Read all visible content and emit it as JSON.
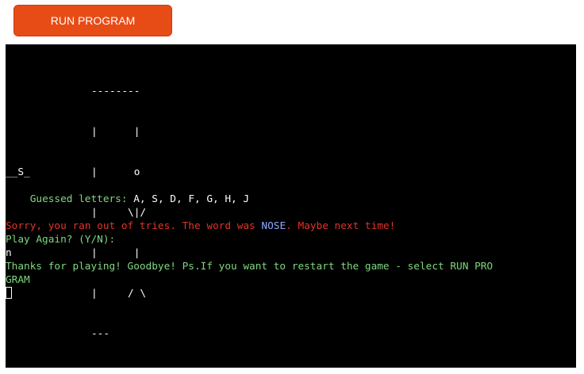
{
  "toolbar": {
    "run_label": "RUN PROGRAM"
  },
  "terminal": {
    "gallows_lines": [
      "--------",
      "|      |",
      "|      o",
      "|     \\|/",
      "|      |",
      "|     / \\",
      "---"
    ],
    "word_display": "__S_",
    "guessed_label": "Guessed letters:",
    "guessed_letters": "A, S, D, F, G, H, J",
    "sorry_prefix": "Sorry, you ran out of tries. The word was",
    "secret_word": "NOSE",
    "sorry_suffix": ". Maybe next time!",
    "play_again_prompt": "Play Again? (Y/N):",
    "user_input": "n",
    "goodbye_line_1": "Thanks for playing! Goodbye! Ps.If you want to restart the game - select RUN PRO",
    "goodbye_line_2": "GRAM"
  },
  "colors": {
    "button": "#e84c16",
    "terminal_bg": "#000000",
    "green": "#7fd77f",
    "red": "#e3322a",
    "blue": "#8fa8ff"
  }
}
